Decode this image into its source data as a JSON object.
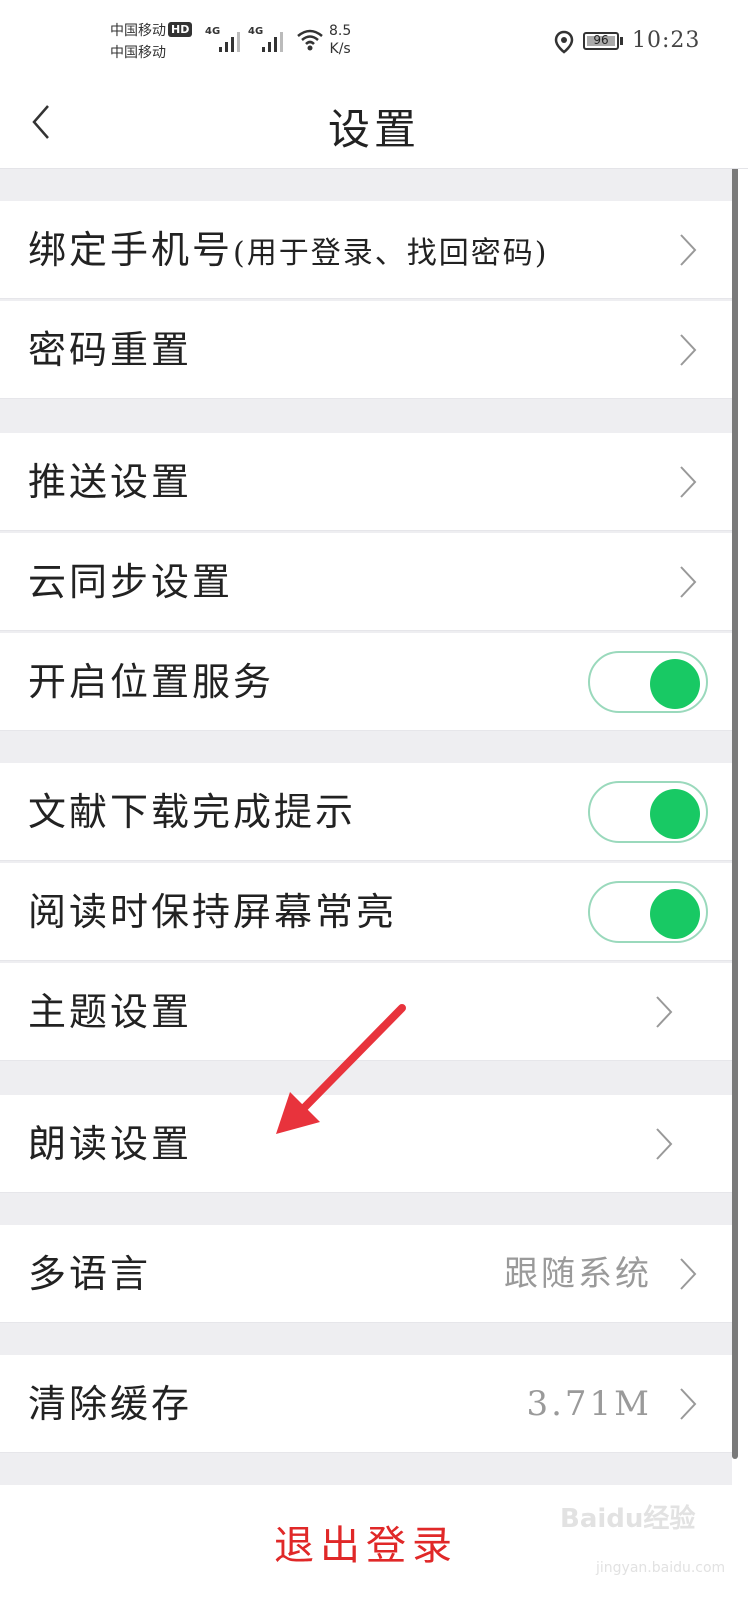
{
  "status_bar": {
    "carrier_1": "中国移动",
    "hd": "HD",
    "carrier_2": "中国移动",
    "net_1": "4G",
    "net_2": "4G",
    "speed_value": "8.5",
    "speed_unit": "K/s",
    "battery": "96",
    "time": "10:23"
  },
  "header": {
    "title": "设置"
  },
  "rows": [
    {
      "label": "绑定手机号",
      "sub": "(用于登录、找回密码)",
      "kind": "chevron"
    },
    {
      "label": "密码重置",
      "kind": "chevron"
    },
    {
      "label": "推送设置",
      "kind": "chevron"
    },
    {
      "label": "云同步设置",
      "kind": "chevron"
    },
    {
      "label": "开启位置服务",
      "kind": "toggle",
      "on": true
    },
    {
      "label": "文献下载完成提示",
      "kind": "toggle",
      "on": true
    },
    {
      "label": "阅读时保持屏幕常亮",
      "kind": "toggle",
      "on": true
    },
    {
      "label": "主题设置",
      "kind": "chevron"
    },
    {
      "label": "朗读设置",
      "kind": "chevron"
    },
    {
      "label": "多语言",
      "value": "跟随系统",
      "kind": "chevron"
    },
    {
      "label": "清除缓存",
      "value": "3.71M",
      "kind": "chevron"
    }
  ],
  "logout": {
    "label": "退出登录"
  },
  "watermark": {
    "brand": "Baidu经验",
    "url": "jingyan.baidu.com"
  },
  "colors": {
    "toggle_on": "#18c964",
    "logout": "#e02828",
    "annotation_arrow": "#e8333c"
  }
}
